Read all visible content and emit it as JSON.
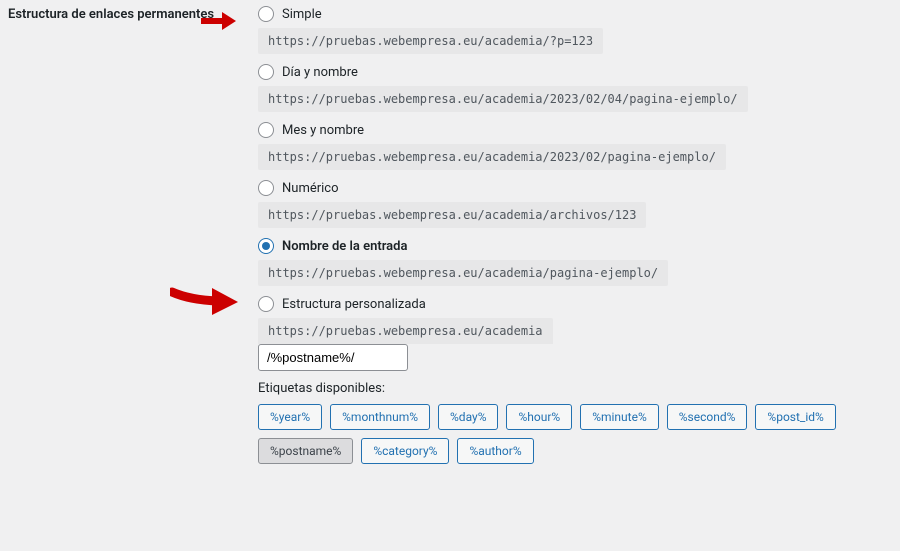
{
  "section_title": "Estructura de enlaces permanentes",
  "options": [
    {
      "label": "Simple",
      "url": "https://pruebas.webempresa.eu/academia/?p=123",
      "selected": false
    },
    {
      "label": "Día y nombre",
      "url": "https://pruebas.webempresa.eu/academia/2023/02/04/pagina-ejemplo/",
      "selected": false
    },
    {
      "label": "Mes y nombre",
      "url": "https://pruebas.webempresa.eu/academia/2023/02/pagina-ejemplo/",
      "selected": false
    },
    {
      "label": "Numérico",
      "url": "https://pruebas.webempresa.eu/academia/archivos/123",
      "selected": false
    },
    {
      "label": "Nombre de la entrada",
      "url": "https://pruebas.webempresa.eu/academia/pagina-ejemplo/",
      "selected": true
    },
    {
      "label": "Estructura personalizada",
      "url_prefix": "https://pruebas.webempresa.eu/academia",
      "input_value": "/%postname%/",
      "selected": false
    }
  ],
  "tags_label": "Etiquetas disponibles:",
  "tags": [
    {
      "text": "%year%",
      "active": false
    },
    {
      "text": "%monthnum%",
      "active": false
    },
    {
      "text": "%day%",
      "active": false
    },
    {
      "text": "%hour%",
      "active": false
    },
    {
      "text": "%minute%",
      "active": false
    },
    {
      "text": "%second%",
      "active": false
    },
    {
      "text": "%post_id%",
      "active": false
    },
    {
      "text": "%postname%",
      "active": true
    },
    {
      "text": "%category%",
      "active": false
    },
    {
      "text": "%author%",
      "active": false
    }
  ]
}
